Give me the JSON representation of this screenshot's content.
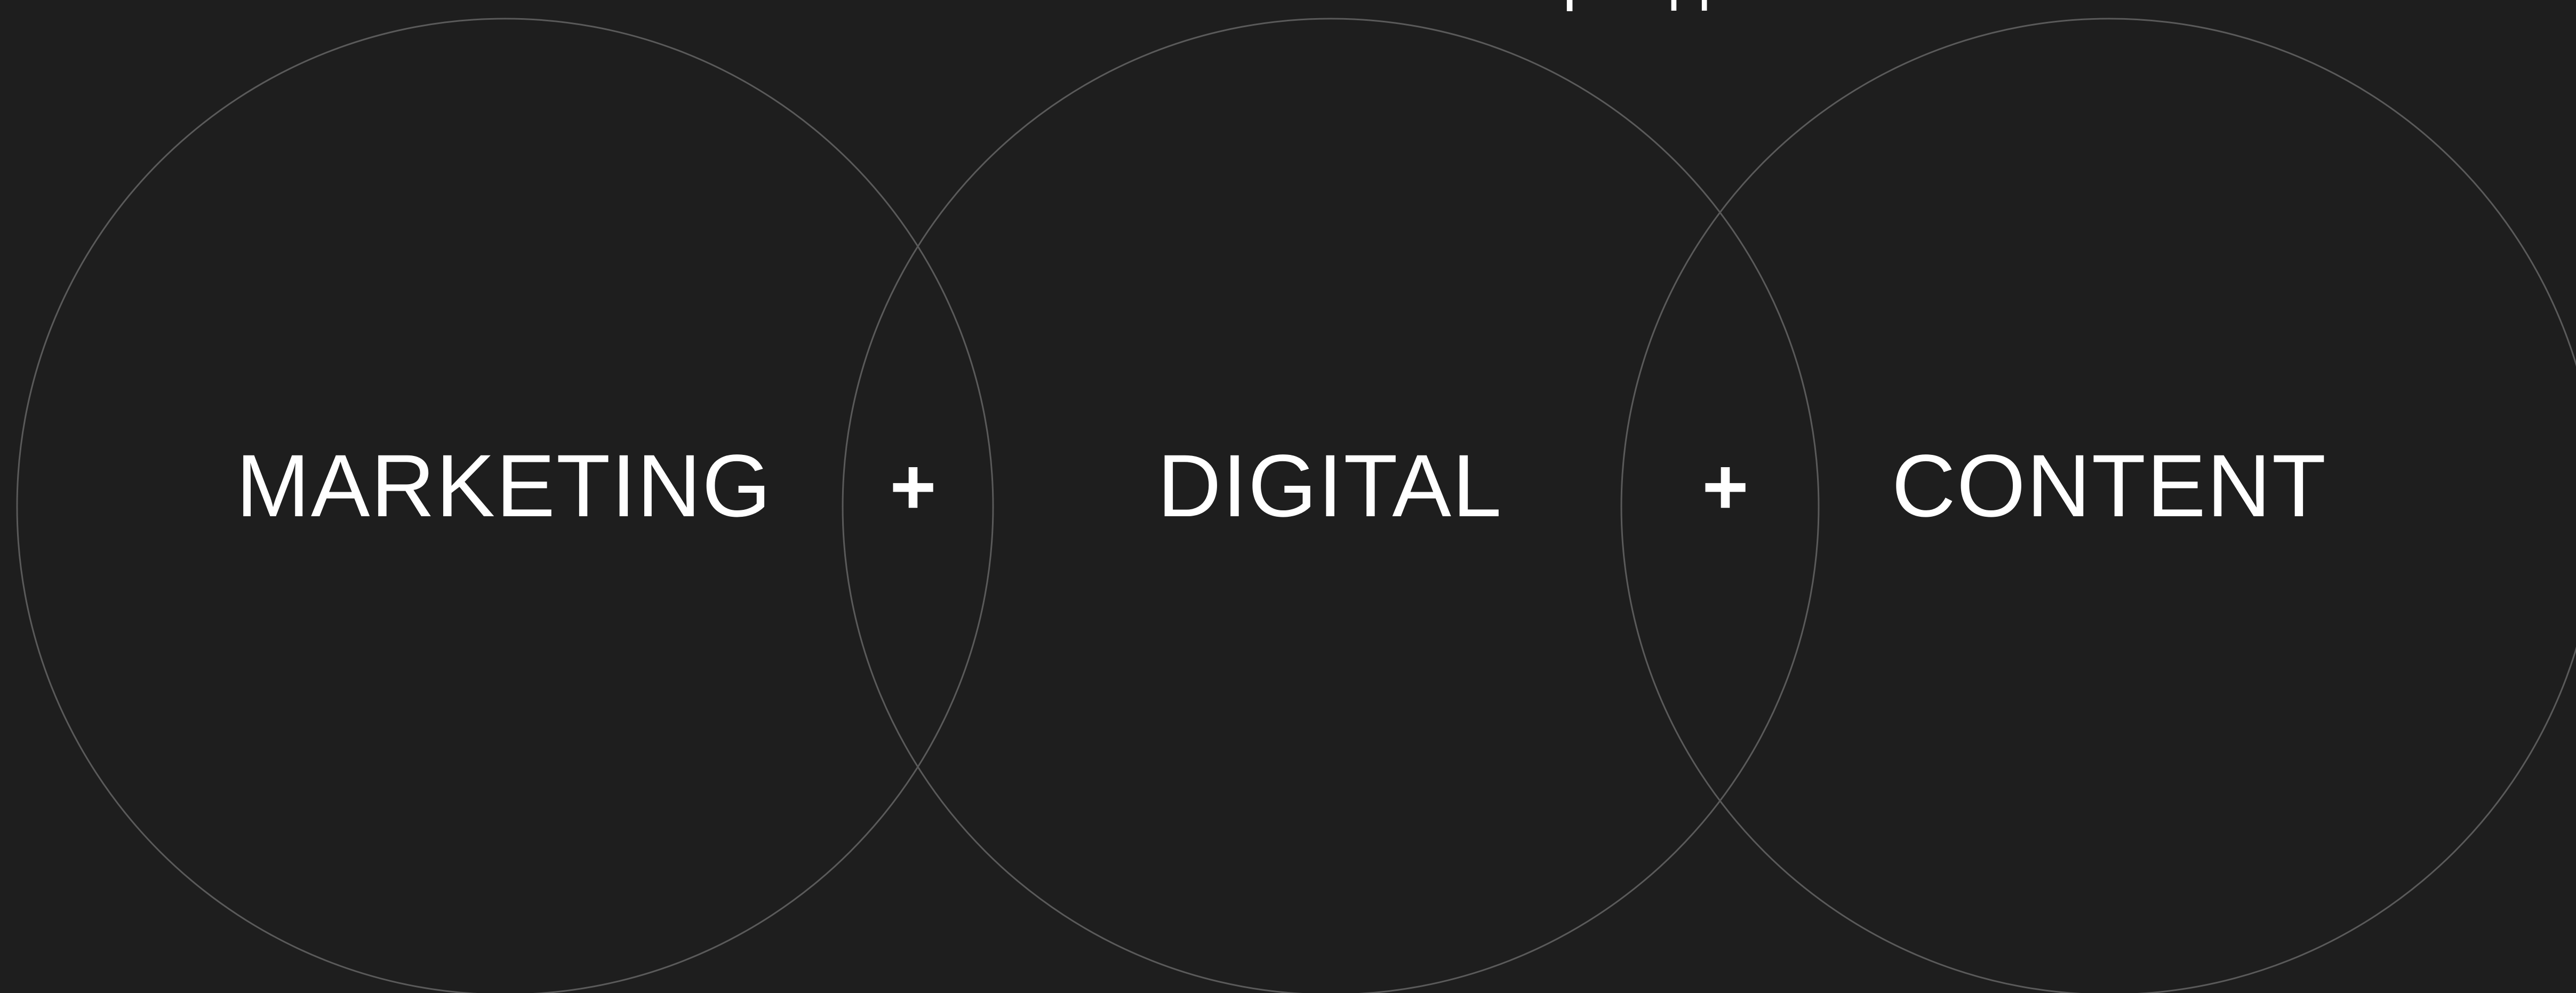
{
  "colors": {
    "background": "#1e1e1e",
    "circle_stroke": "#5a5a5a",
    "text": "#ffffff"
  },
  "header_fragment": "бренда.",
  "labels": {
    "marketing": "MARKETING",
    "digital": "DIGITAL",
    "content": "CONTENT"
  },
  "operators": {
    "first": "+",
    "second": "+"
  }
}
